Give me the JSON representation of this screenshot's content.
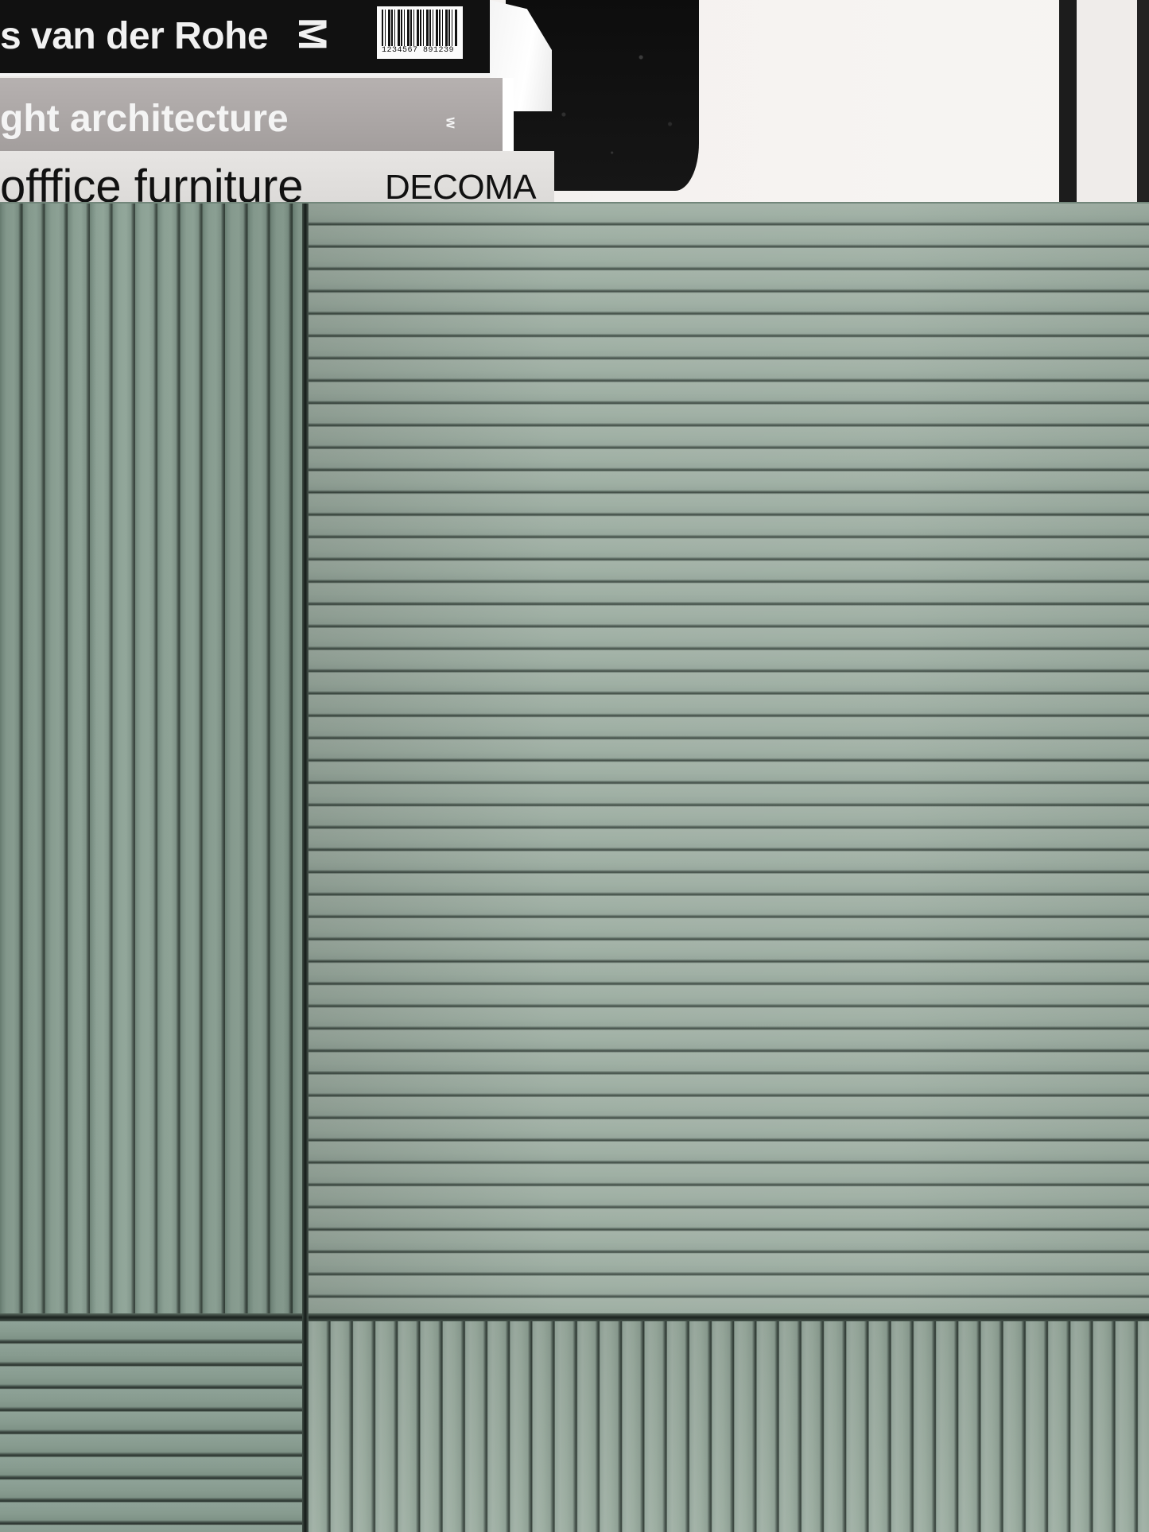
{
  "photo": {
    "subject": "stack of books on a sage green fluted cabinet",
    "palette": {
      "cabinet": "#8fa195",
      "cabinet_groove": "#2f3a34",
      "wall": "#f3f0ee",
      "art": "#111111"
    }
  },
  "books": [
    {
      "spine": "s van der Rohe",
      "logo": "M",
      "barcode_number": "1234567 891239"
    },
    {
      "spine": "ght architecture",
      "mark": "w"
    },
    {
      "spine": "offfice furniture",
      "brand": "DECOMA"
    }
  ]
}
